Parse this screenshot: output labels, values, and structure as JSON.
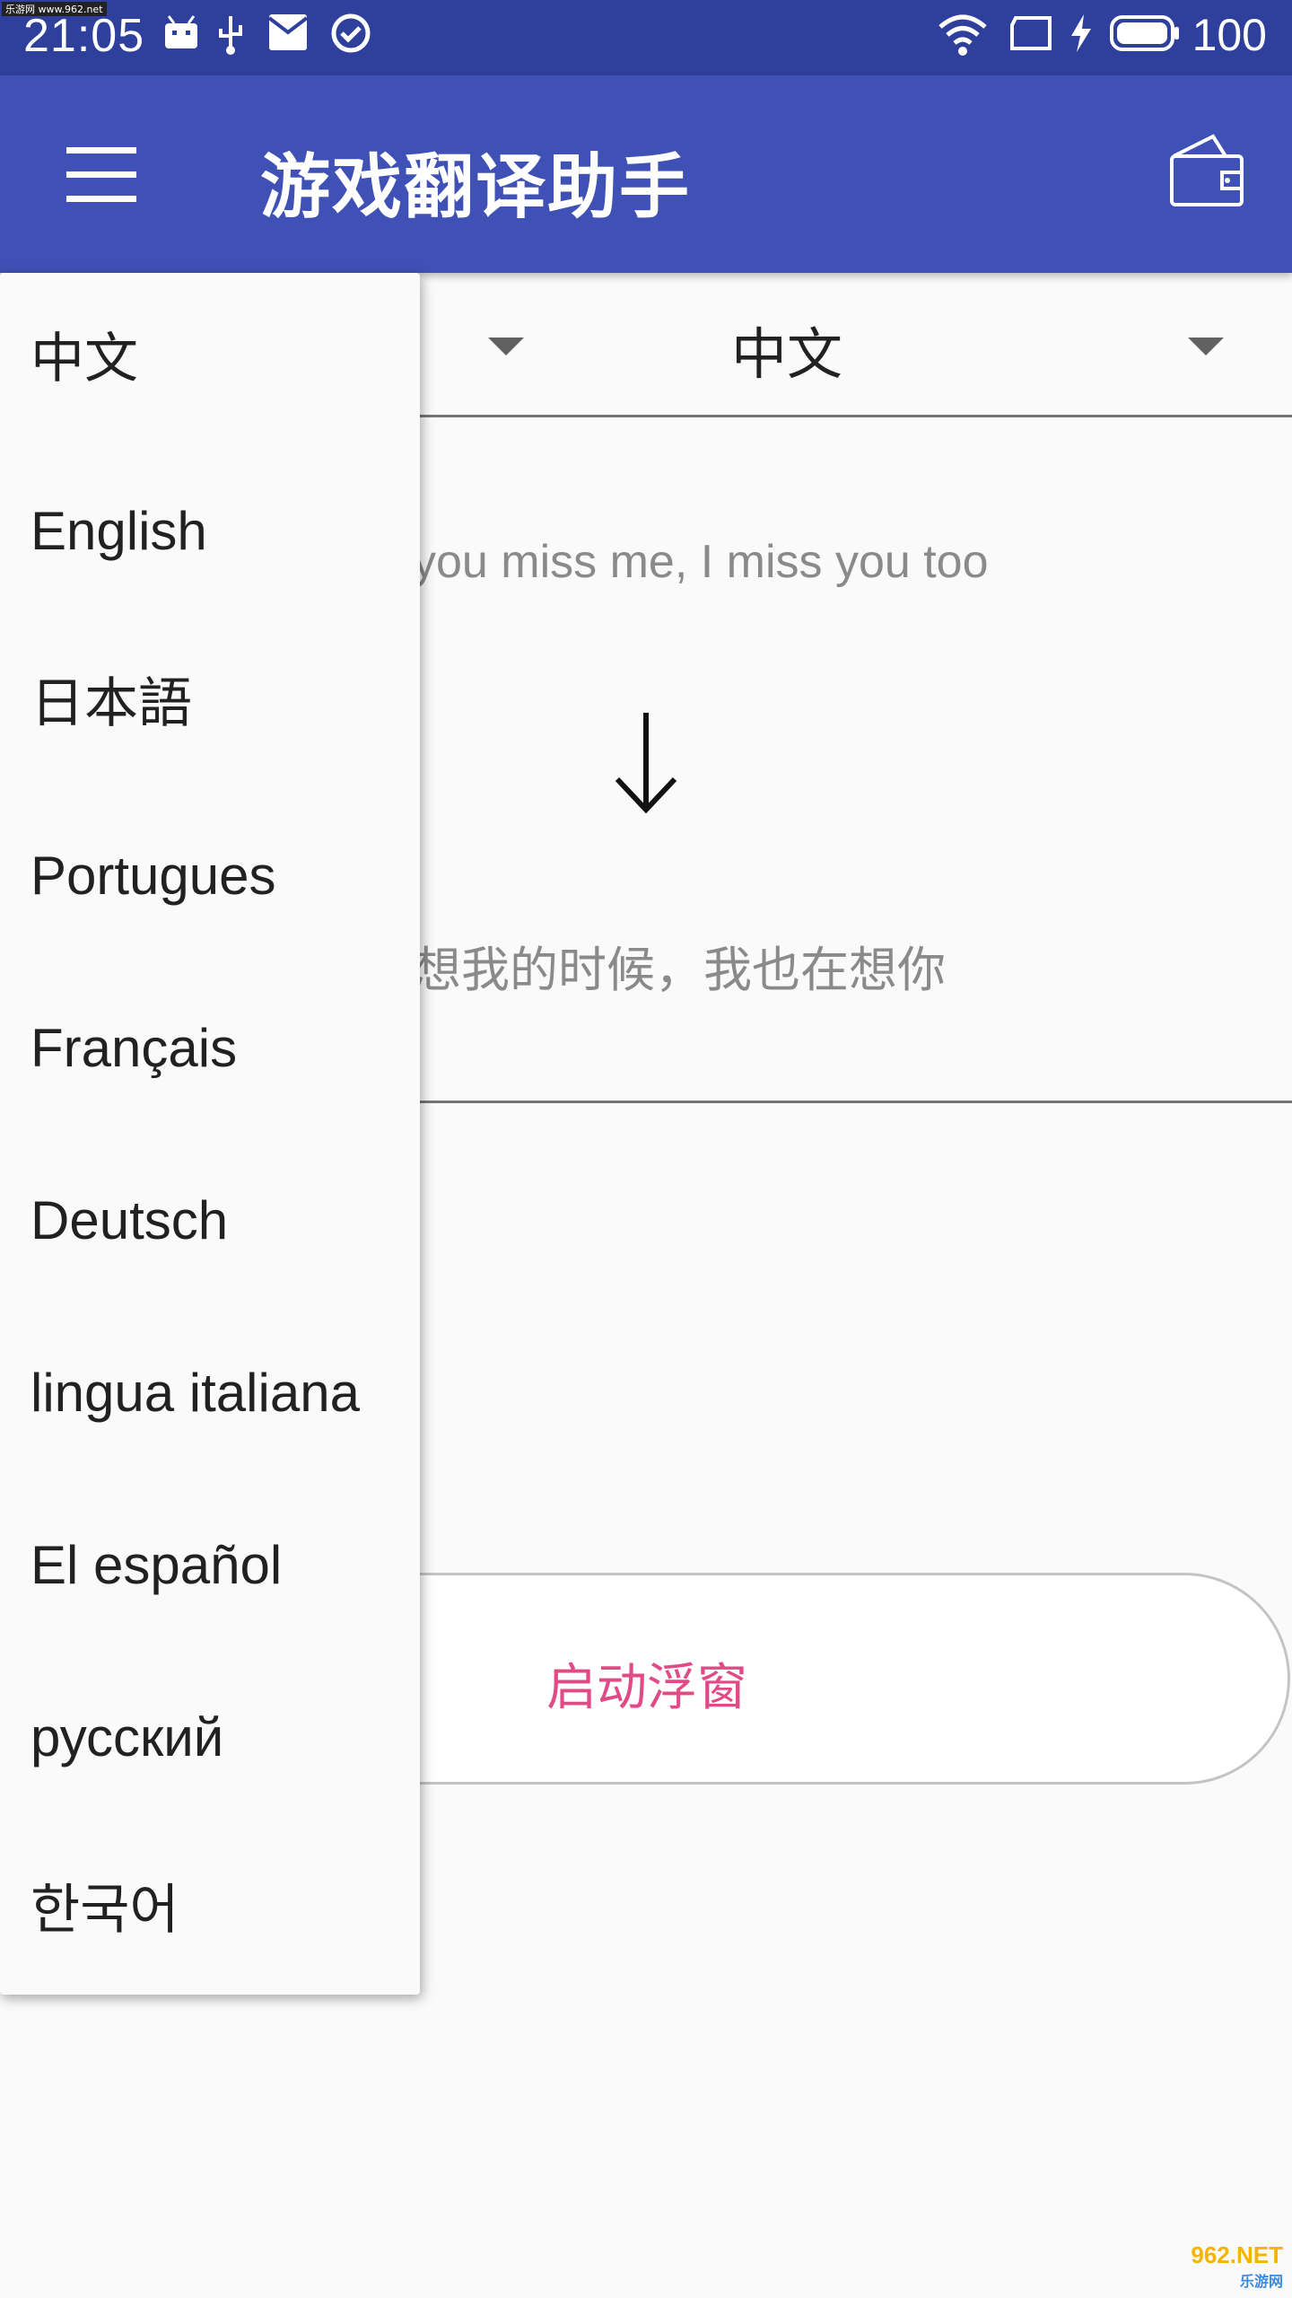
{
  "status_bar": {
    "time": "21:05",
    "battery": "100",
    "watermark": "乐游网 www.962.net",
    "left_icons": [
      "android-icon",
      "usb-icon",
      "mail-icon",
      "check-circle-icon"
    ],
    "right_icons": [
      "wifi-icon",
      "screen-icon",
      "charging-icon",
      "battery-icon"
    ]
  },
  "app_bar": {
    "title": "游戏翻译助手",
    "menu_icon": "hamburger-menu-icon",
    "wallet_icon": "wallet-icon",
    "color": "#3f51b5"
  },
  "language_selector": {
    "target_language": "中文"
  },
  "translation": {
    "source_text": "you miss me, I miss you too",
    "result_text": "想我的时候，我也在想你",
    "arrow_icon": "arrow-down-icon"
  },
  "float_button": {
    "label": "启动浮窗",
    "label_color": "#e04a86"
  },
  "dropdown": {
    "options": [
      "中文",
      "English",
      "日本語",
      "Portugues",
      "Français",
      "Deutsch",
      "lingua italiana",
      "El español",
      "русский",
      "한국어"
    ]
  },
  "bottom_watermark": {
    "brand": "962.NET",
    "sub": "乐游网"
  }
}
